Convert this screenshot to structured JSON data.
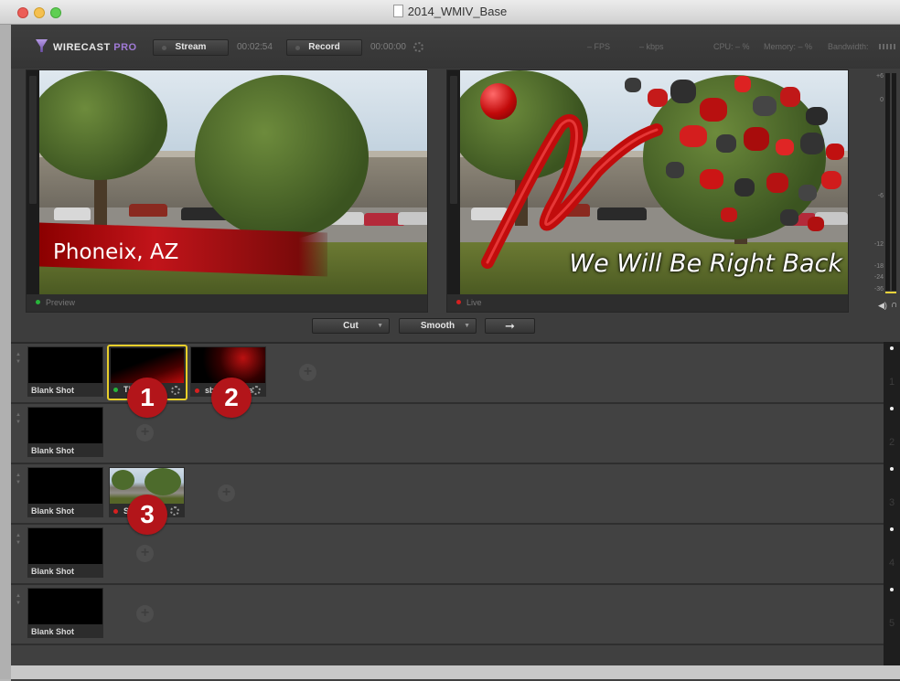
{
  "window": {
    "title": "2014_WMIV_Base"
  },
  "toolbar": {
    "logo_main": "WIRECAST",
    "logo_pro": "PRO",
    "stream_label": "Stream",
    "stream_time": "00:02:54",
    "record_label": "Record",
    "record_time": "00:00:00",
    "fps": "– FPS",
    "kbps": "– kbps",
    "cpu": "CPU: – %",
    "memory": "Memory: – %",
    "bandwidth": "Bandwidth:"
  },
  "preview": {
    "caption": "Preview",
    "overlay_text": "Phoneix, AZ",
    "indicator_color": "#27b53a"
  },
  "live": {
    "caption": "Live",
    "overlay_text": "We Will Be Right Back",
    "indicator_color": "#d62020"
  },
  "meter": {
    "labels": [
      "+6",
      "0",
      "-6",
      "-12",
      "-18",
      "-24",
      "-36"
    ],
    "level": 0.0
  },
  "transitions": {
    "cut_label": "Cut",
    "smooth_label": "Smooth",
    "go_icon": "arrow-right-icon"
  },
  "layers": [
    {
      "number": "1",
      "shots": [
        {
          "name": "Blank Shot",
          "type": "blank"
        },
        {
          "name": "Title",
          "type": "title",
          "selected": true,
          "status_color": "#27b53a"
        },
        {
          "name": "sb_titlerOve",
          "type": "brb",
          "status_color": "#d62020"
        }
      ]
    },
    {
      "number": "2",
      "shots": [
        {
          "name": "Blank Shot",
          "type": "blank"
        }
      ]
    },
    {
      "number": "3",
      "shots": [
        {
          "name": "Blank Shot",
          "type": "blank"
        },
        {
          "name": "SDI",
          "type": "camera",
          "status_color": "#d62020"
        }
      ]
    },
    {
      "number": "4",
      "shots": [
        {
          "name": "Blank Shot",
          "type": "blank"
        }
      ]
    },
    {
      "number": "5",
      "shots": [
        {
          "name": "Blank Shot",
          "type": "blank"
        }
      ]
    }
  ],
  "badges": [
    "1",
    "2",
    "3"
  ],
  "colors": {
    "accent_pro": "#a07ad6",
    "selected_border": "#e8cf2a",
    "badge": "#b3151a",
    "live_red": "#d62020",
    "preview_green": "#27b53a"
  }
}
